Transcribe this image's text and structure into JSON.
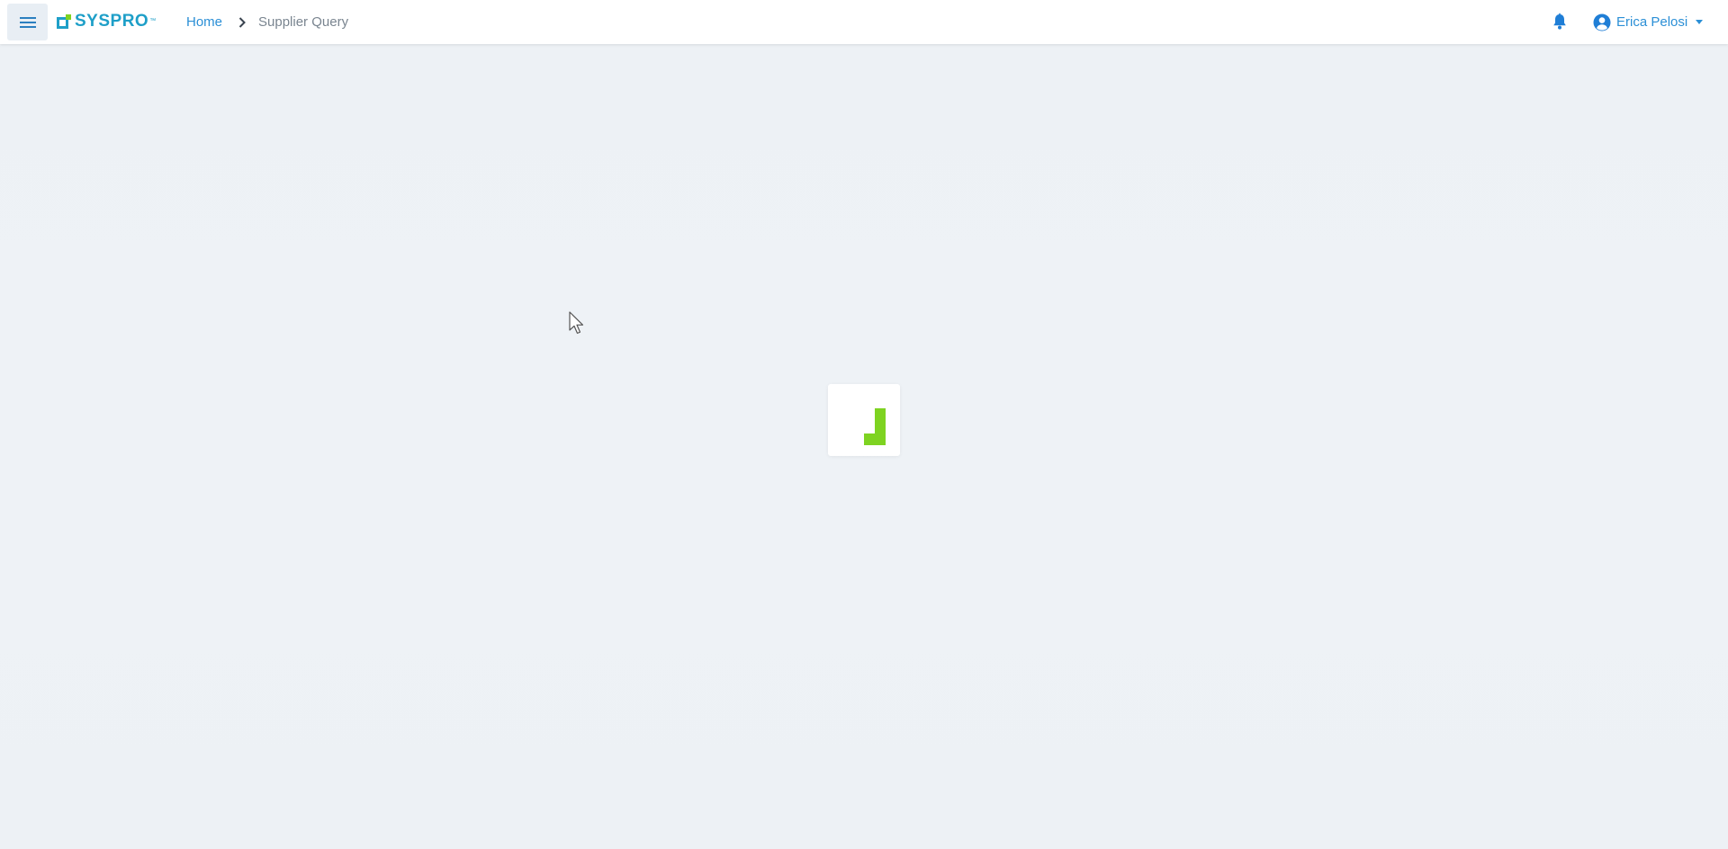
{
  "header": {
    "menu_icon": "hamburger-menu-icon",
    "logo_text": "SYSPRO",
    "logo_tm": "™",
    "breadcrumb": {
      "home": "Home",
      "current": "Supplier Query"
    },
    "notifications_icon": "bell-icon",
    "user": {
      "name": "Erica Pelosi",
      "avatar_icon": "user-circle-icon",
      "caret_icon": "caret-down-icon"
    }
  },
  "main": {
    "loading_indicator_icon": "loading-spinner-icon"
  },
  "colors": {
    "accent": "#2b8fd6",
    "logo": "#1e9fc8",
    "loader_green": "#7ed321",
    "background": "#eef2f6"
  }
}
